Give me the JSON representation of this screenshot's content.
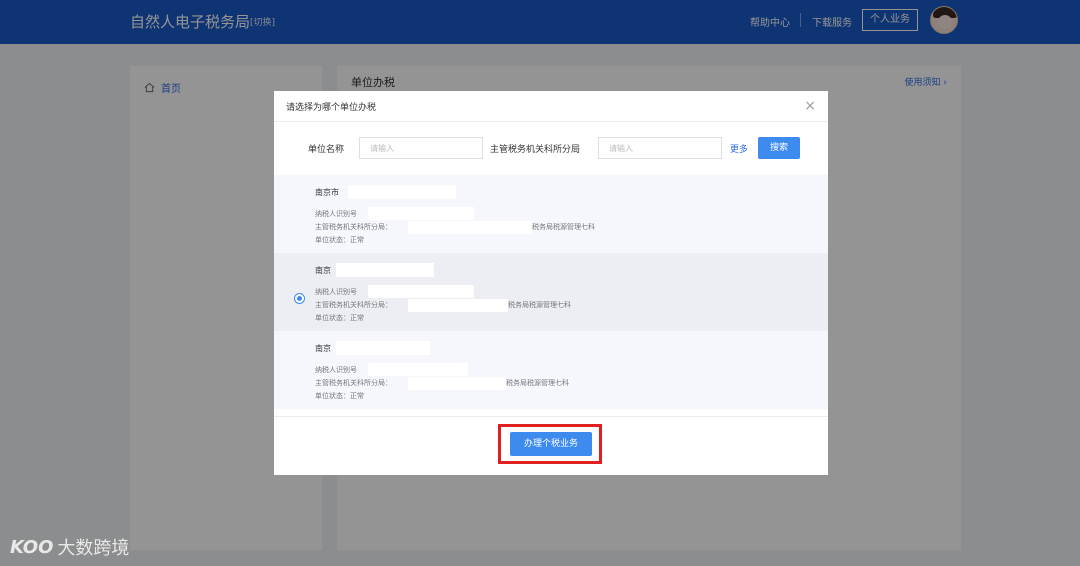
{
  "header": {
    "brand": "自然人电子税务局",
    "switch_label": "[切换]",
    "help": "帮助中心",
    "download": "下载服务",
    "personal": "个人业务"
  },
  "sidebar": {
    "home": "首页"
  },
  "main": {
    "title": "单位办税",
    "notice": "使用须知 ›"
  },
  "modal": {
    "title": "请选择为哪个单位办税",
    "close": "×",
    "fields": {
      "unit_name_label": "单位名称",
      "unit_name_placeholder": "请输入",
      "tax_office_label": "主管税务机关科所分局",
      "tax_office_placeholder": "请输入"
    },
    "more": "更多",
    "search": "搜索",
    "items": [
      {
        "name": "南京市",
        "taxpayer_label": "纳税人识别号",
        "office_label": "主管税务机关科所分局：",
        "office_suffix": "税务局税源管理七科",
        "status": "单位状态：正常",
        "selected": false
      },
      {
        "name": "南京",
        "taxpayer_label": "纳税人识别号",
        "office_label": "主管税务机关科所分局：",
        "office_suffix": "税务局税源管理七科",
        "status": "单位状态：正常",
        "selected": true
      },
      {
        "name": "南京",
        "taxpayer_label": "纳税人识别号",
        "office_label": "主管税务机关科所分局：",
        "office_suffix": "税务局税源管理七科",
        "status": "单位状态：正常",
        "selected": false
      }
    ],
    "submit": "办理个税业务"
  },
  "watermark": {
    "logo": "KOO",
    "text": "大数跨境"
  },
  "colors": {
    "primary": "#1a5bc7",
    "button": "#3e8bf0",
    "highlight": "#e02020"
  }
}
